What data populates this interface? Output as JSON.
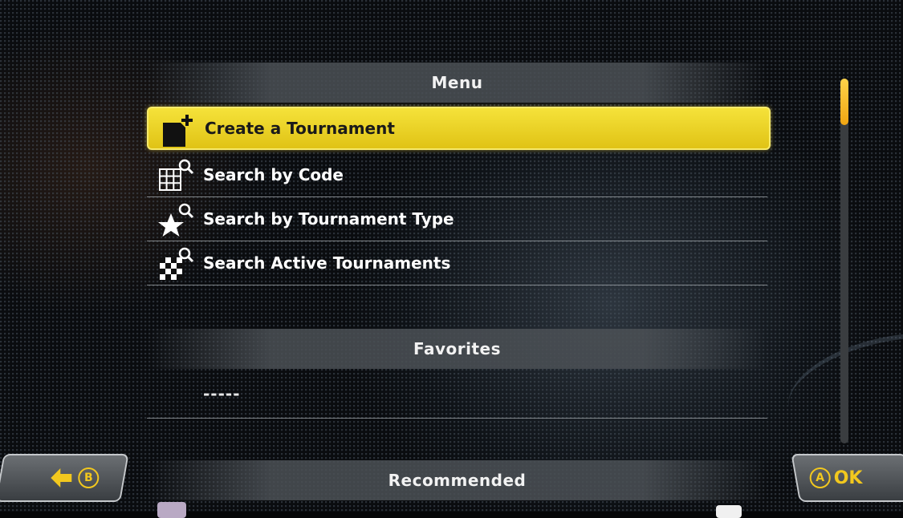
{
  "menu": {
    "header": "Menu",
    "items": [
      {
        "label": "Create a Tournament",
        "icon": "new-document-plus-icon"
      },
      {
        "label": "Search by Code",
        "icon": "grid-search-icon"
      },
      {
        "label": "Search by Tournament Type",
        "icon": "star-search-icon"
      },
      {
        "label": "Search Active Tournaments",
        "icon": "checkered-flag-search-icon"
      }
    ]
  },
  "favorites": {
    "header": "Favorites",
    "empty_value": "-----"
  },
  "recommended": {
    "header": "Recommended"
  },
  "buttons": {
    "back_glyph": "B",
    "ok_glyph": "A",
    "ok_label": "OK"
  },
  "colors": {
    "selection": "#f0d625",
    "accent": "#f2c81e"
  }
}
